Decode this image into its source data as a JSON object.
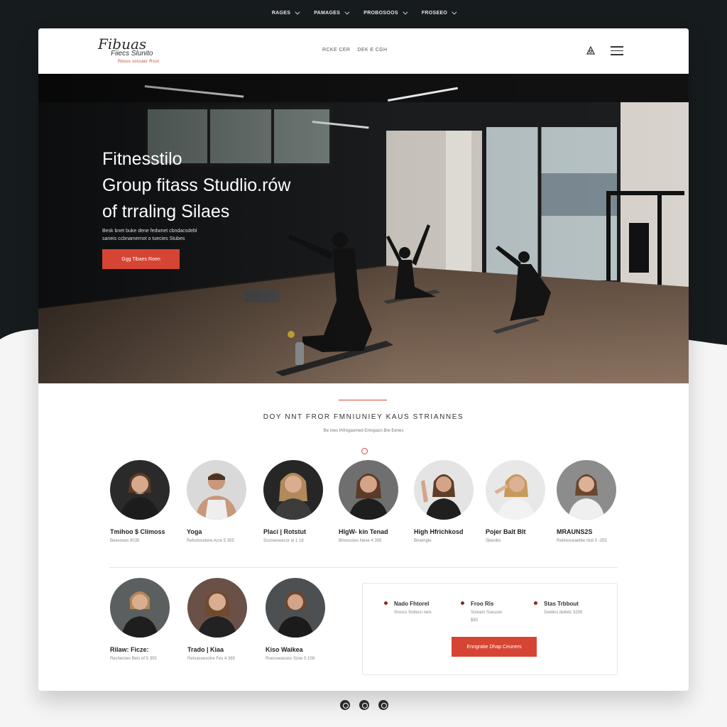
{
  "top_nav": {
    "items": [
      {
        "label": "RAGES"
      },
      {
        "label": "PAMAGES"
      },
      {
        "label": "PROBOSOOS"
      },
      {
        "label": "FROSEEO"
      }
    ]
  },
  "header": {
    "logo_script": "Fibuas",
    "logo_sub": "Fiiecs Slunito",
    "logo_tag": "Resus sossaer Rssn",
    "links": [
      "RCKE CER",
      "DEK E CGH"
    ]
  },
  "hero": {
    "title_line1": "Fitnesstilo",
    "title_line2": "Group fitass Studlio.rów",
    "title_line3": "of trraling Silaes",
    "desc_line1": "Besk bnet buke dene fedwnet cbndacsdebl",
    "desc_line2": "saneis ccbnamernot o tuecies Stubes",
    "cta": "Ggg Tibaes Roen"
  },
  "trainers_section": {
    "title": "DOY NNT FROR FMNIUNIEY KAUS STRIANNES",
    "subtitle": "Be mes fAfrogasmed Enrspacn Bre Eenes"
  },
  "trainers": [
    {
      "name": "Tmihoo $ Climoss",
      "meta": "Beexoses 9035"
    },
    {
      "name": "Yoga",
      "meta": "Refurtosotere Acre 5 355"
    },
    {
      "name": "Placi | Rotstut",
      "meta": "Scoreeseecor ei  1  18"
    },
    {
      "name": "HIgW- kin Tenad",
      "meta": "Btrexsstes Neve  4  355"
    },
    {
      "name": "High Hfrichkosd",
      "meta": "Bineingle"
    },
    {
      "name": "Pojer Balt Blt",
      "meta": "Sbesibs"
    },
    {
      "name": "MRAUNS2S",
      "meta": "Retiresceaetbe rbdi  5 -255"
    },
    {
      "name": "Rilaw: Ficze:",
      "meta": "Recheroes Beis ef  5 305"
    },
    {
      "name": "Trado | Kiaa",
      "meta": "Retsasoesotre Fes  4 365"
    },
    {
      "name": "Kiso Waikea",
      "meta": "Roesswasoes Siste  5 158"
    }
  ],
  "schedule": {
    "columns": [
      {
        "label": "Nado Fhtorel",
        "lines": [
          "Sroscs Sotlecn neis"
        ]
      },
      {
        "label": "Froo Ris",
        "lines": [
          "Scteam Ssescec",
          "$50"
        ]
      },
      {
        "label": "Stas Trbbout",
        "lines": [
          "Soebns deiletc 3200"
        ]
      }
    ],
    "cta": "Enngratie Dhap Ceuners"
  },
  "colors": {
    "accent": "#d64534",
    "dark_bg": "#161b1e"
  }
}
